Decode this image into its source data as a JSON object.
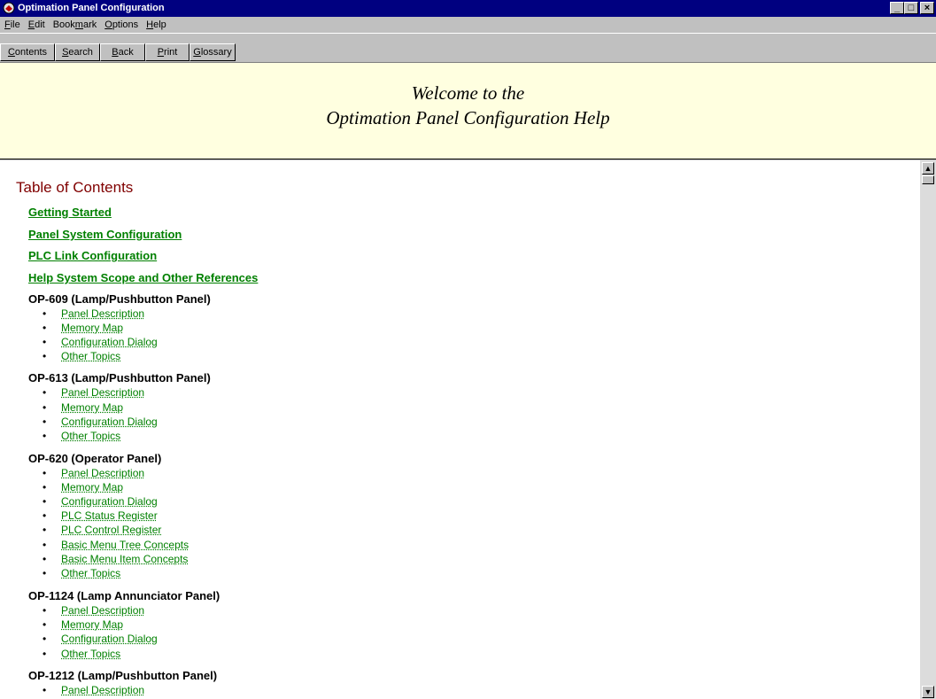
{
  "window": {
    "title": "Optimation Panel Configuration",
    "min_label": "_",
    "max_label": "□",
    "close_label": "×"
  },
  "menu": [
    {
      "underline": "F",
      "rest": "ile"
    },
    {
      "underline": "E",
      "rest": "dit"
    },
    {
      "pre": "Book",
      "underline": "m",
      "rest": "ark"
    },
    {
      "underline": "O",
      "rest": "ptions"
    },
    {
      "underline": "H",
      "rest": "elp"
    }
  ],
  "toolbar": [
    {
      "underline": "C",
      "rest": "ontents"
    },
    {
      "underline": "S",
      "rest": "earch"
    },
    {
      "underline": "B",
      "rest": "ack"
    },
    {
      "underline": "P",
      "rest": "rint"
    },
    {
      "underline": "G",
      "rest": "lossary"
    }
  ],
  "header": {
    "line1": "Welcome to the",
    "line2": "Optimation Panel Configuration Help"
  },
  "toc": {
    "heading": "Table of Contents",
    "top_links": [
      "Getting Started",
      "Panel System Configuration",
      "PLC Link Configuration",
      "Help System Scope and Other References"
    ],
    "sections": [
      {
        "title": "OP-609 (Lamp/Pushbutton Panel)",
        "items": [
          "Panel Description",
          "Memory Map",
          "Configuration Dialog",
          "Other Topics"
        ]
      },
      {
        "title": "OP-613 (Lamp/Pushbutton Panel)",
        "items": [
          "Panel Description",
          "Memory Map",
          "Configuration Dialog",
          "Other Topics"
        ]
      },
      {
        "title": "OP-620 (Operator Panel)",
        "items": [
          "Panel Description",
          "Memory Map",
          "Configuration Dialog",
          "PLC Status Register",
          "PLC Control Register",
          "Basic Menu Tree Concepts",
          "Basic Menu Item Concepts",
          "Other Topics"
        ]
      },
      {
        "title": "OP-1124 (Lamp Annunciator Panel)",
        "items": [
          "Panel Description",
          "Memory Map",
          "Configuration Dialog",
          "Other Topics"
        ]
      },
      {
        "title": "OP-1212 (Lamp/Pushbutton Panel)",
        "items": [
          "Panel Description"
        ]
      }
    ]
  },
  "colors": {
    "titlebar": "#000080",
    "header_bg": "#ffffe0",
    "link": "#008000",
    "toc_heading": "#800000"
  },
  "icons": {
    "app": "help-book-icon",
    "scroll_up": "scroll-up-arrow-icon",
    "scroll_down": "scroll-down-arrow-icon"
  }
}
